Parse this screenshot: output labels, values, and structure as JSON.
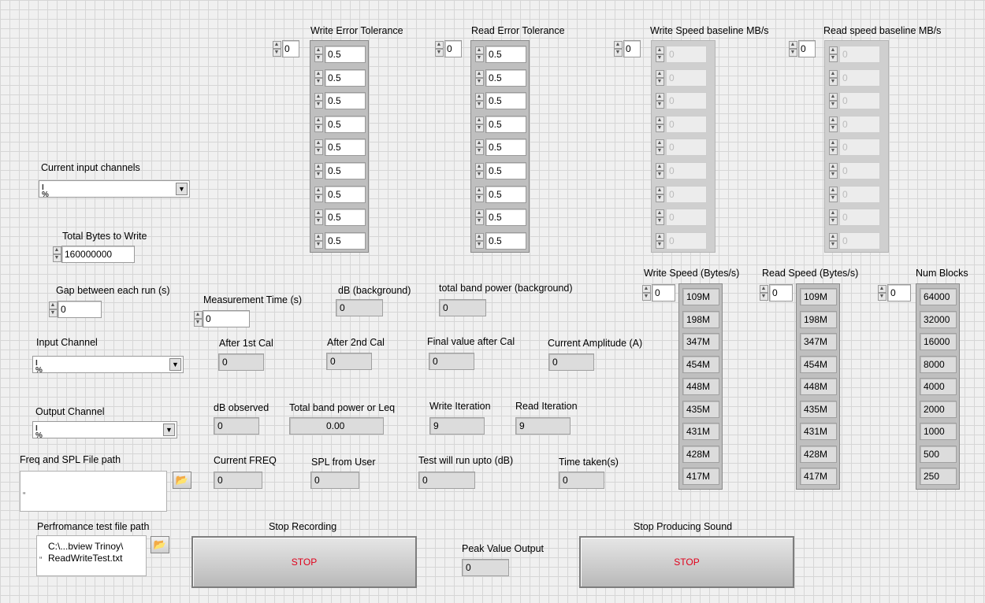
{
  "arrays": {
    "write_error_tolerance": {
      "label": "Write Error Tolerance",
      "index": "0",
      "values": [
        "0.5",
        "0.5",
        "0.5",
        "0.5",
        "0.5",
        "0.5",
        "0.5",
        "0.5",
        "0.5"
      ]
    },
    "read_error_tolerance": {
      "label": "Read Error Tolerance",
      "index": "0",
      "values": [
        "0.5",
        "0.5",
        "0.5",
        "0.5",
        "0.5",
        "0.5",
        "0.5",
        "0.5",
        "0.5"
      ]
    },
    "write_speed_baseline": {
      "label": "Write Speed baseline MB/s",
      "index": "0",
      "values": [
        "0",
        "0",
        "0",
        "0",
        "0",
        "0",
        "0",
        "0",
        "0"
      ]
    },
    "read_speed_baseline": {
      "label": "Read speed baseline MB/s",
      "index": "0",
      "values": [
        "0",
        "0",
        "0",
        "0",
        "0",
        "0",
        "0",
        "0",
        "0"
      ]
    },
    "write_speed": {
      "label": "Write Speed (Bytes/s)",
      "index": "0",
      "values": [
        "109M",
        "198M",
        "347M",
        "454M",
        "448M",
        "435M",
        "431M",
        "428M",
        "417M"
      ]
    },
    "read_speed": {
      "label": "Read Speed (Bytes/s)",
      "index": "0",
      "values": [
        "109M",
        "198M",
        "347M",
        "454M",
        "448M",
        "435M",
        "431M",
        "428M",
        "417M"
      ]
    },
    "num_blocks": {
      "label": "Num Blocks",
      "index": "0",
      "values": [
        "64000",
        "32000",
        "16000",
        "8000",
        "4000",
        "2000",
        "1000",
        "500",
        "250"
      ]
    }
  },
  "current_input_channels": {
    "label": "Current input channels",
    "value": ""
  },
  "total_bytes": {
    "label": "Total Bytes to Write",
    "value": "160000000"
  },
  "gap": {
    "label": "Gap between each run (s)",
    "value": "0"
  },
  "measurement_time": {
    "label": "Measurement Time (s)",
    "value": "0"
  },
  "db_background": {
    "label": "dB (background)",
    "value": "0"
  },
  "total_band_background": {
    "label": "total band power (background)",
    "value": "0"
  },
  "input_channel": {
    "label": "Input Channel",
    "value": ""
  },
  "after_1st_cal": {
    "label": "After 1st Cal",
    "value": "0"
  },
  "after_2nd_cal": {
    "label": "After 2nd Cal",
    "value": "0"
  },
  "final_value": {
    "label": "Final value after Cal",
    "value": "0"
  },
  "current_amplitude": {
    "label": "Current Amplitude (A)",
    "value": "0"
  },
  "output_channel": {
    "label": "Output Channel",
    "value": ""
  },
  "db_observed": {
    "label": "dB observed",
    "value": "0"
  },
  "total_band_leq": {
    "label": "Total band power or Leq",
    "value": "0.00"
  },
  "write_iteration": {
    "label": "Write Iteration",
    "value": "9"
  },
  "read_iteration": {
    "label": "Read Iteration",
    "value": "9"
  },
  "freq_spl_path": {
    "label": "Freq and SPL File path",
    "value": ""
  },
  "current_freq": {
    "label": "Current FREQ",
    "value": "0"
  },
  "spl_from_user": {
    "label": "SPL from User",
    "value": "0"
  },
  "test_run_upto": {
    "label": "Test will run upto (dB)",
    "value": "0"
  },
  "time_taken": {
    "label": "Time taken(s)",
    "value": "0"
  },
  "perf_test_path": {
    "label": "Perfromance test file path",
    "line1": "C:\\...bview Trinoy\\",
    "line2": "ReadWriteTest.txt"
  },
  "stop_recording": {
    "label": "Stop Recording",
    "button": "STOP"
  },
  "peak_value": {
    "label": "Peak Value Output",
    "value": "0"
  },
  "stop_sound": {
    "label": "Stop Producing Sound",
    "button": "STOP"
  }
}
